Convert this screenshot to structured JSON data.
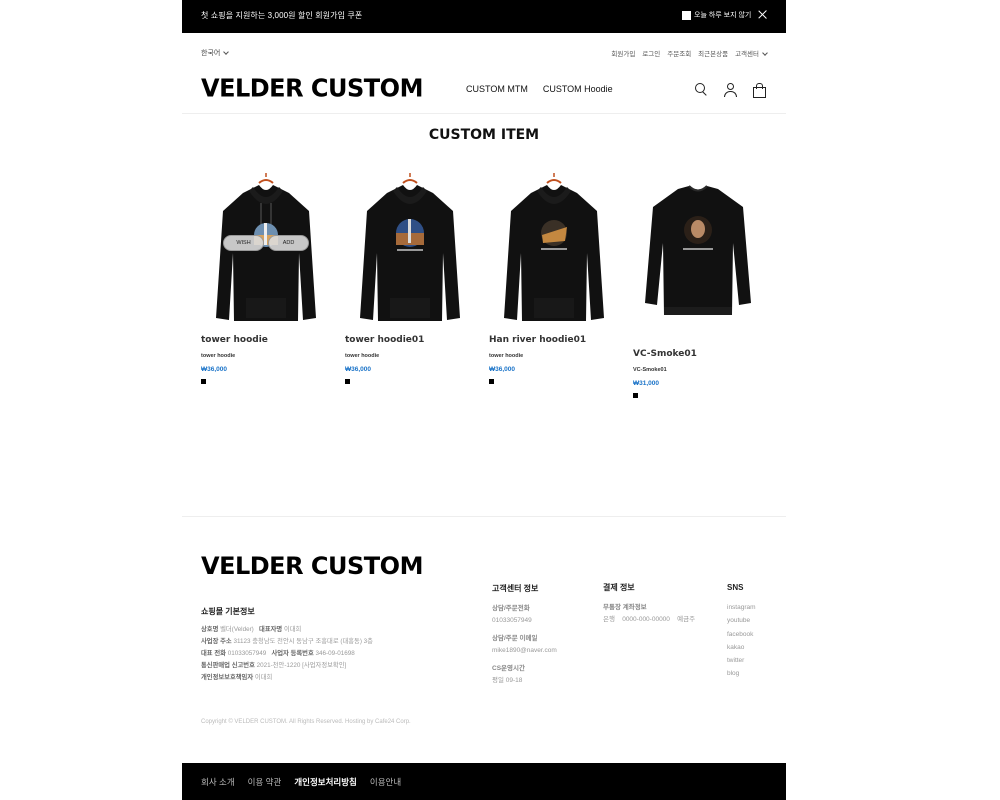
{
  "banner": {
    "message": "첫 쇼핑을 지원하는 3,000원 할인 회원가입 쿠폰",
    "today_close": "오늘 하루 보지 않기"
  },
  "util": {
    "language": "한국어",
    "links": [
      "회원가입",
      "로그인",
      "주문조회",
      "최근본상품",
      "고객센터"
    ]
  },
  "header": {
    "logo": "VELDER CUSTOM",
    "nav": [
      "CUSTOM MTM",
      "CUSTOM Hoodie"
    ]
  },
  "section": {
    "title": "CUSTOM ITEM"
  },
  "overlay": {
    "wish": "WISH",
    "add": "ADD"
  },
  "products": [
    {
      "name": "tower hoodie",
      "sub": "tower hoodie",
      "price": "₩36,000",
      "type": "hoodie",
      "print": "tower"
    },
    {
      "name": "tower hoodie01",
      "sub": "tower hoodie",
      "price": "₩36,000",
      "type": "hoodie",
      "print": "tower01"
    },
    {
      "name": "Han river hoodie01",
      "sub": "tower hoodie",
      "price": "₩36,000",
      "type": "hoodie",
      "print": "han"
    },
    {
      "name": "VC-Smoke01",
      "sub": "VC-Smoke01",
      "price": "₩31,000",
      "type": "mtm",
      "print": "smoke"
    }
  ],
  "footer": {
    "logo": "VELDER CUSTOM",
    "shop_info_title": "쇼핑몰 기본정보",
    "shop_info": {
      "l1_label": "상호명",
      "l1_value": "벨더(Velder)",
      "l1_label2": "대표자명",
      "l1_value2": "이대희",
      "l2_label": "사업장 주소",
      "l2_value": "31123 충청남도 천안시 동남구 조흥대로 (대흥동) 3층",
      "l3_label": "대표 전화",
      "l3_value": "01033057949",
      "l3_label2": "사업자 등록번호",
      "l3_value2": "346-09-01698",
      "l4_label": "통신판매업 신고번호",
      "l4_value": "2021-천안-1220 [사업자정보확인]",
      "l5_label": "개인정보보호책임자",
      "l5_value": "이대희"
    },
    "cs": {
      "title": "고객센터 정보",
      "phone_label": "상담/주문전화",
      "phone": "01033057949",
      "email_label": "상담/주문 이메일",
      "email": "mike1890@naver.com",
      "hours_label": "CS운영시간",
      "hours": "평일 09-18"
    },
    "pay": {
      "title": "결제 정보",
      "label": "무통장 계좌정보",
      "bank": "은행",
      "account": "0000-000-00000",
      "holder": "예금주"
    },
    "sns": {
      "title": "SNS",
      "items": [
        "instagram",
        "youtube",
        "facebook",
        "kakao",
        "twitter",
        "blog"
      ]
    },
    "copyright": "Copyright © VELDER CUSTOM. All Rights Reserved. Hosting by Cafe24 Corp."
  },
  "bottom_bar": {
    "items": [
      "회사 소개",
      "이용 약관",
      "개인정보처리방침",
      "이용안내"
    ],
    "active_index": 2
  }
}
